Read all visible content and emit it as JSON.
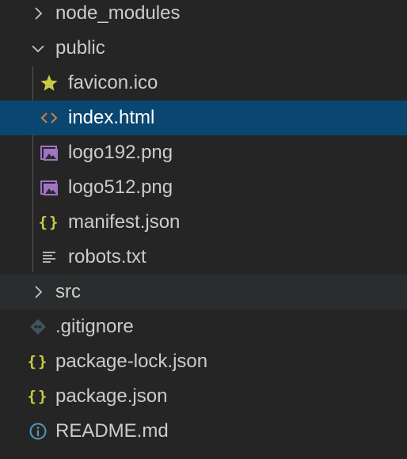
{
  "explorer": {
    "items": [
      {
        "label": "node_modules",
        "icon": "chevron-right-icon"
      },
      {
        "label": "public",
        "icon": "chevron-down-icon"
      },
      {
        "label": "favicon.ico",
        "icon": "star-icon"
      },
      {
        "label": "index.html",
        "icon": "html-code-icon"
      },
      {
        "label": "logo192.png",
        "icon": "image-icon"
      },
      {
        "label": "logo512.png",
        "icon": "image-icon"
      },
      {
        "label": "manifest.json",
        "icon": "json-braces-icon"
      },
      {
        "label": "robots.txt",
        "icon": "text-lines-icon"
      },
      {
        "label": "src",
        "icon": "chevron-right-icon"
      },
      {
        "label": ".gitignore",
        "icon": "git-icon"
      },
      {
        "label": "package-lock.json",
        "icon": "json-braces-icon"
      },
      {
        "label": "package.json",
        "icon": "json-braces-icon"
      },
      {
        "label": "README.md",
        "icon": "info-icon"
      }
    ],
    "selected_item": "index.html",
    "hovered_item": "src",
    "colors": {
      "background": "#252526",
      "selected_background": "#094771",
      "hover_background": "#2a2d2e",
      "text": "#cccccc",
      "star": "#cbcb41",
      "json": "#cbcb41",
      "html": "#e37933",
      "image": "#a074c4",
      "git": "#41535b",
      "info": "#519aba"
    }
  }
}
